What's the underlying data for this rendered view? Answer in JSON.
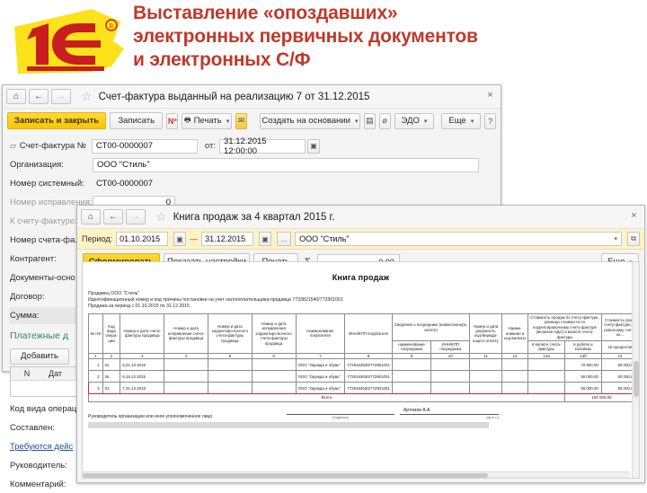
{
  "slide": {
    "title_lines": [
      "Выставление «опоздавших»",
      "электронных первичных документов",
      "и электронных С/Ф"
    ],
    "title_color": "#c0392b",
    "logo_alt": "1C"
  },
  "window1": {
    "nav": {
      "home": "⌂",
      "back": "←",
      "forward": "→",
      "favorite": "☆"
    },
    "title": "Счет-фактура выданный на реализацию 7 от 31.12.2015",
    "close": "×",
    "toolbar": {
      "save_close": "Записать и закрыть",
      "save": "Записать",
      "tax_icon": "Nº",
      "print": "Печать",
      "print_caret": "▾",
      "mail_icon": "✉",
      "create_based": "Создать на основании",
      "create_caret": "▾",
      "report_icon": "▤",
      "attach_icon": "⌀",
      "edo": "ЭДО",
      "edo_caret": "▾",
      "more": "Еще",
      "more_caret": "▾",
      "help": "?"
    },
    "fields": [
      {
        "label": "Счет-фактура №",
        "value": "СТ00-0000007",
        "sub_label": "от:",
        "sub_value": "31.12.2015 12:00:00"
      },
      {
        "label": "Организация:",
        "value": "ООО \"Стиль\""
      },
      {
        "label": "Номер системный:",
        "value": "СТ00-0000007"
      },
      {
        "label": "Номер исправления:",
        "value": "0"
      },
      {
        "label": "К счету-фактуре:",
        "value": ""
      },
      {
        "label": "Номер счета-фа...",
        "value": ""
      },
      {
        "label": "Контрагент:",
        "value": ""
      },
      {
        "label": "Документы-осно",
        "value": ""
      },
      {
        "label": "Договор:",
        "value": ""
      },
      {
        "label": "Сумма:",
        "value": ""
      }
    ],
    "payment_section": "Платежные д",
    "add_button": "Добавить",
    "mini_table_headers": [
      "N",
      "Дат"
    ],
    "lower_fields": [
      "Код вида операц",
      "Составлен:",
      "Требуются дейс",
      "Руководитель:",
      "Комментарий:"
    ]
  },
  "window2": {
    "nav": {
      "home": "⌂",
      "back": "←",
      "forward": "→",
      "favorite": "☆"
    },
    "title": "Книга продаж за 4 квартал 2015 г.",
    "close": "×",
    "period": {
      "label": "Период:",
      "from": "01.10.2015",
      "dash": "—",
      "to": "31.12.2015",
      "calendar_icon": "▣",
      "ellipsis_button": "...",
      "organization": "ООО \"Стиль\"",
      "org_caret": "▾",
      "org_open_icon": "⧉"
    },
    "toolbar": {
      "generate": "Сформировать",
      "show_settings": "Показать настройки",
      "print": "Печать",
      "sigma": "Σ",
      "sum_value": "0,00",
      "more": "Еще",
      "more_caret": "▾"
    },
    "report": {
      "title": "Книга продаж",
      "seller_line": "Продавец  ООО \"Стиль\"",
      "inn_line": "Идентификационный номер и код причины постановки на учет налогоплательщика-продавца  7733821540/773301001",
      "period_line": "Продажа за период с 01.10.2015 по 31.12.2015",
      "headers_top": [
        "№ п/п",
        "Код вида опера-ции",
        "Номер и дата счета-фактуры продавца",
        "Номер и дата исправления счета-фактуры продавца",
        "Номер и дата корректиро-вочного счета-фактуры продавца",
        "Номер и дата исправления корректиро-вочного счета-фактуры продавца",
        "Наименование покупателя",
        "ИНН/КПП покупателя",
        "Сведения о посреднике (комиссионере, агенте)",
        "Номер и дата документа, подтвержда-ющего оплату",
        "Наиме-нование и код валюты",
        "Стоимость продаж по счету-фактуре, разница стоимости по корректировочному счету-фактуре (включая НДС) в валюте счета-фактуры",
        "Стоимость про... счету-фактуре, ... ровочному счет... ко..."
      ],
      "headers_sub": [
        "наименование посредника",
        "ИНН/КПП посредника",
        "в валюте счета-фактуры",
        "в рублях и копейках",
        "18 процентов"
      ],
      "col_numbers": [
        "1",
        "2",
        "3",
        "4",
        "5",
        "6",
        "7",
        "8",
        "9",
        "10",
        "11",
        "12",
        "13а",
        "13б",
        "14"
      ],
      "rows": [
        {
          "n": "1",
          "op": "01",
          "invoice": "6,31.10.2015",
          "corr_fix": "",
          "corr": "",
          "corr_fix2": "",
          "buyer": "ООО \"Одежда и обувь\"",
          "inn_kpp": "7729163630/772901001",
          "mediator": "",
          "mediator_inn": "",
          "pay_doc": "",
          "currency": "",
          "amount_cur": "",
          "amount_rub": "70 800,00",
          "amount_18": "60 000,00",
          "highlight": false
        },
        {
          "n": "2",
          "op": "26",
          "invoice": "6,15.12.2015",
          "corr_fix": "",
          "corr": "",
          "corr_fix2": "",
          "buyer": "ООО \"Одежда и обувь\"",
          "inn_kpp": "7729163630/772901001",
          "mediator": "",
          "mediator_inn": "",
          "pay_doc": "",
          "currency": "",
          "amount_cur": "",
          "amount_rub": "59 000,00",
          "amount_18": "50 000,00",
          "highlight": false
        },
        {
          "n": "3",
          "op": "01",
          "invoice": "7,31.12.2015",
          "corr_fix": "",
          "corr": "",
          "corr_fix2": "",
          "buyer": "ООО \"Одежда и обувь\"",
          "inn_kpp": "7729163630/772901001",
          "mediator": "",
          "mediator_inn": "",
          "pay_doc": "",
          "currency": "",
          "amount_cur": "",
          "amount_rub": "59 000,00",
          "amount_18": "50 000,00",
          "highlight": true
        }
      ],
      "total_label": "Всего",
      "total_value": "160 000,00",
      "footer_text": "Руководитель организации или иное уполномоченное лицо",
      "signature_caption": "(подпись)",
      "signer_name": "Артемов А.А.",
      "signer_caption": "(ф.и.о.)"
    }
  }
}
